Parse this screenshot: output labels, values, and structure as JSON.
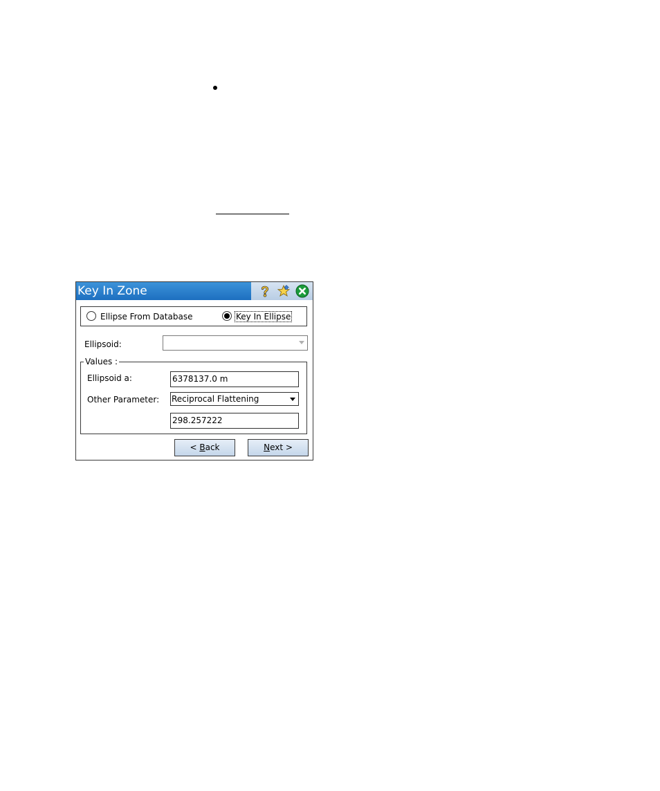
{
  "window": {
    "title": "Key In Zone",
    "icons": [
      "help-icon",
      "favorites-star-icon",
      "close-icon"
    ]
  },
  "source": {
    "option_database": "Ellipse From Database",
    "option_key_in": "Key In Ellipse",
    "selected": "Key In Ellipse"
  },
  "ellipsoid": {
    "label": "Ellipsoid:",
    "value": ""
  },
  "values": {
    "legend": "Values :",
    "ellipsoid_a_label": "Ellipsoid a:",
    "ellipsoid_a_value": "6378137.0 m",
    "other_param_label": "Other Parameter:",
    "other_param_value": "Reciprocal Flattening",
    "other_param_number": "298.257222"
  },
  "buttons": {
    "back_prefix": "< ",
    "back_hotkey": "B",
    "back_rest": "ack",
    "next_hotkey": "N",
    "next_rest": "ext >"
  },
  "colors": {
    "title_bar": "#1d6fc0",
    "button_fill": "#c4d6ea",
    "close_icon": "#1a9b3a"
  }
}
